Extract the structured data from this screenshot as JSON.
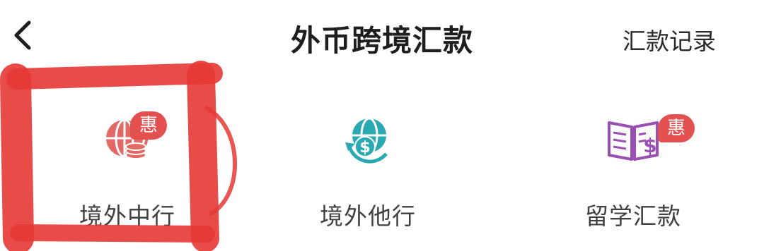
{
  "header": {
    "back_icon": "chevron-left-icon",
    "title": "外币跨境汇款",
    "record_label": "汇款记录"
  },
  "items": [
    {
      "label": "境外中行",
      "icon": "globe-coins-icon",
      "badge": "惠",
      "icon_color": "#e36a64"
    },
    {
      "label": "境外他行",
      "icon": "globe-dollar-icon",
      "badge": "",
      "icon_color": "#2aa9b2"
    },
    {
      "label": "留学汇款",
      "icon": "book-dollar-icon",
      "badge": "惠",
      "icon_color": "#9a4fb3"
    }
  ],
  "colors": {
    "badge": "#e2504f",
    "annotation_marker": "#e53935"
  }
}
